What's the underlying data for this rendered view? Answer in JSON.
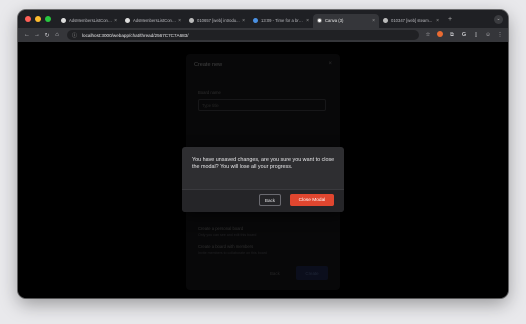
{
  "browser": {
    "tabs": [
      {
        "label": "AdsMembersListContain...",
        "icon": "github-icon",
        "active": false
      },
      {
        "label": "AdsMembersListContain...",
        "icon": "github-icon",
        "active": false
      },
      {
        "label": "010657 [web] introdu...",
        "icon": "app-icon",
        "active": false
      },
      {
        "label": "13:09 - Time for a break!",
        "icon": "clock-icon",
        "active": false
      },
      {
        "label": "Canva (3)",
        "icon": "canva-icon",
        "active": true
      },
      {
        "label": "010347 [web] steam...",
        "icon": "app-icon",
        "active": false
      }
    ],
    "new_tab_label": "+",
    "url": "localhost:3000/webapp/chat/thread/2567C7C7A683/"
  },
  "background_dialog": {
    "title": "Create new",
    "close": "×",
    "field_label": "Board name",
    "field_placeholder": "Type title",
    "options": [
      {
        "title": "Create a personal board",
        "desc": "Only you can see and edit this board"
      },
      {
        "title": "Create a board with members",
        "desc": "Invite members to collaborate on this board"
      }
    ],
    "back_label": "Back",
    "create_label": "Create"
  },
  "modal": {
    "message": "You have unsaved changes, are you sure you want to close the modal? You will lose all your progress.",
    "back_label": "Back",
    "close_label": "Close Modal"
  },
  "colors": {
    "accent_danger": "#e0462f",
    "modal_bg": "#2e2e31",
    "backdrop": "#000000"
  }
}
